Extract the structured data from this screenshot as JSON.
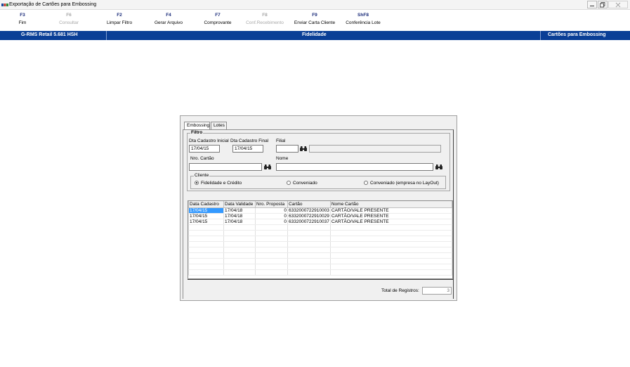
{
  "window": {
    "title": "Exportação de Cartões para Embossing"
  },
  "toolbar": {
    "items": [
      {
        "key": "F3",
        "label": "Fim",
        "enabled": true
      },
      {
        "key": "F6",
        "label": "Consultar",
        "enabled": false
      },
      {
        "key": "F2",
        "label": "Limpar Filtro",
        "enabled": true
      },
      {
        "key": "F4",
        "label": "Gerar Arquivo",
        "enabled": true
      },
      {
        "key": "F7",
        "label": "Comprovante",
        "enabled": true
      },
      {
        "key": "F8",
        "label": "Conf.Recebimento",
        "enabled": false
      },
      {
        "key": "F9",
        "label": "Enviar Carta Cliente",
        "enabled": true
      },
      {
        "key": "ShF8",
        "label": "Conferência Lote",
        "enabled": true
      }
    ]
  },
  "statusbar": {
    "left": "G-RMS Retail 5.681 HSH",
    "center": "Fidelidade",
    "right": "Cartões para Embossing"
  },
  "tabs": [
    "Embossing",
    "Lotes"
  ],
  "filter": {
    "legend": "Filtro",
    "dt_inicial_label": "Dta Cadastro Inicial",
    "dt_inicial_value": "17/04/15",
    "dt_final_label": "Dta Cadastro Final",
    "dt_final_value": "17/04/15",
    "filial_label": "Filial",
    "filial_value": "",
    "nro_cartao_label": "Nro. Cartão",
    "nro_cartao_value": "",
    "nome_label": "Nome",
    "nome_value": "",
    "cliente": {
      "legend": "Cliente",
      "options": [
        "Fidelidade e Crédito",
        "Conveniado",
        "Conveniado (empresa no LayOut)"
      ],
      "selected": "Fidelidade e Crédito"
    }
  },
  "grid": {
    "columns": [
      "Data Cadastro",
      "Data Validade",
      "Nro. Proposta",
      "Cartão",
      "Nome Cartão"
    ],
    "rows": [
      [
        "17/04/15",
        "17/04/18",
        "0",
        "6332000722910003",
        "CARTÃO/VALE PRESENTE"
      ],
      [
        "17/04/15",
        "17/04/18",
        "0",
        "6332000722910029",
        "CARTÃO/VALE PRESENTE"
      ],
      [
        "17/04/15",
        "17/04/18",
        "0",
        "6332000722910037",
        "CARTÃO/VALE PRESENTE"
      ]
    ],
    "empty_rows": 9
  },
  "total": {
    "label": "Total de Registros:",
    "value": "3"
  },
  "icons": {
    "binoculars": "binoculars-icon",
    "app": "app-icon"
  }
}
